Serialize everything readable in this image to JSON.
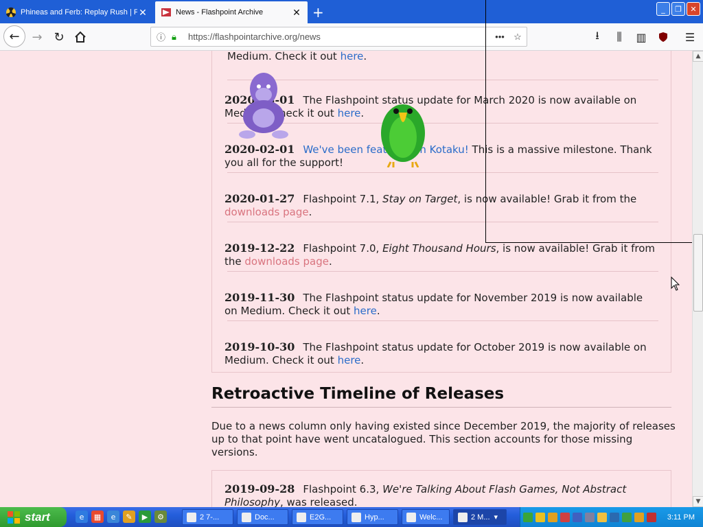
{
  "browser": {
    "tabs": [
      {
        "label": "Phineas and Ferb: Replay Rush | F",
        "active": false
      },
      {
        "label": "News - Flashpoint Archive",
        "active": true
      }
    ],
    "url": "https://flashpointarchive.org/news"
  },
  "news": [
    {
      "date": "",
      "parts": [
        {
          "t": "Medium. Check it out "
        },
        {
          "t": "here",
          "link": "blue"
        },
        {
          "t": "."
        }
      ]
    },
    {
      "date": "2020-03-01",
      "parts": [
        {
          "t": "The Flashpoint status update for March 2020 is now available on Medium. Check it out "
        },
        {
          "t": "here",
          "link": "blue"
        },
        {
          "t": "."
        }
      ]
    },
    {
      "date": "2020-02-01",
      "parts": [
        {
          "t": "We've been featured on Kotaku!",
          "link": "blue"
        },
        {
          "t": " This is a massive milestone. Thank you all for the support!"
        }
      ]
    },
    {
      "date": "2020-01-27",
      "parts": [
        {
          "t": "Flashpoint 7.1, "
        },
        {
          "t": "Stay on Target",
          "em": true
        },
        {
          "t": ", is now available! Grab it from the "
        },
        {
          "t": "downloads page",
          "link": "pink"
        },
        {
          "t": "."
        }
      ]
    },
    {
      "date": "2019-12-22",
      "parts": [
        {
          "t": "Flashpoint 7.0, "
        },
        {
          "t": "Eight Thousand Hours",
          "em": true
        },
        {
          "t": ", is now available! Grab it from the "
        },
        {
          "t": "downloads page",
          "link": "pink"
        },
        {
          "t": "."
        }
      ]
    },
    {
      "date": "2019-11-30",
      "parts": [
        {
          "t": "The Flashpoint status update for November 2019 is now available on Medium. Check it out "
        },
        {
          "t": "here",
          "link": "blue"
        },
        {
          "t": "."
        }
      ]
    },
    {
      "date": "2019-10-30",
      "parts": [
        {
          "t": "The Flashpoint status update for October 2019 is now available on Medium. Check it out "
        },
        {
          "t": "here",
          "link": "blue"
        },
        {
          "t": "."
        }
      ]
    }
  ],
  "retro": {
    "title": "Retroactive Timeline of Releases",
    "paragraph": "Due to a news column only having existed since December 2019, the majority of releases up to that point have went uncatalogued. This section accounts for those missing versions.",
    "first": {
      "date": "2019-09-28",
      "parts": [
        {
          "t": "Flashpoint 6.3, "
        },
        {
          "t": "We're Talking About Flash Games, Not Abstract Philosophy",
          "em": true
        },
        {
          "t": ", was released."
        }
      ]
    }
  },
  "taskbar": {
    "start_label": "start",
    "items": [
      {
        "label": "2 7-...",
        "active": false
      },
      {
        "label": "Doc...",
        "active": false
      },
      {
        "label": "E2G...",
        "active": false
      },
      {
        "label": "Hyp...",
        "active": false
      },
      {
        "label": "Welc...",
        "active": false
      },
      {
        "label": "2 M...",
        "active": true
      }
    ],
    "clock": "3:11 PM"
  }
}
